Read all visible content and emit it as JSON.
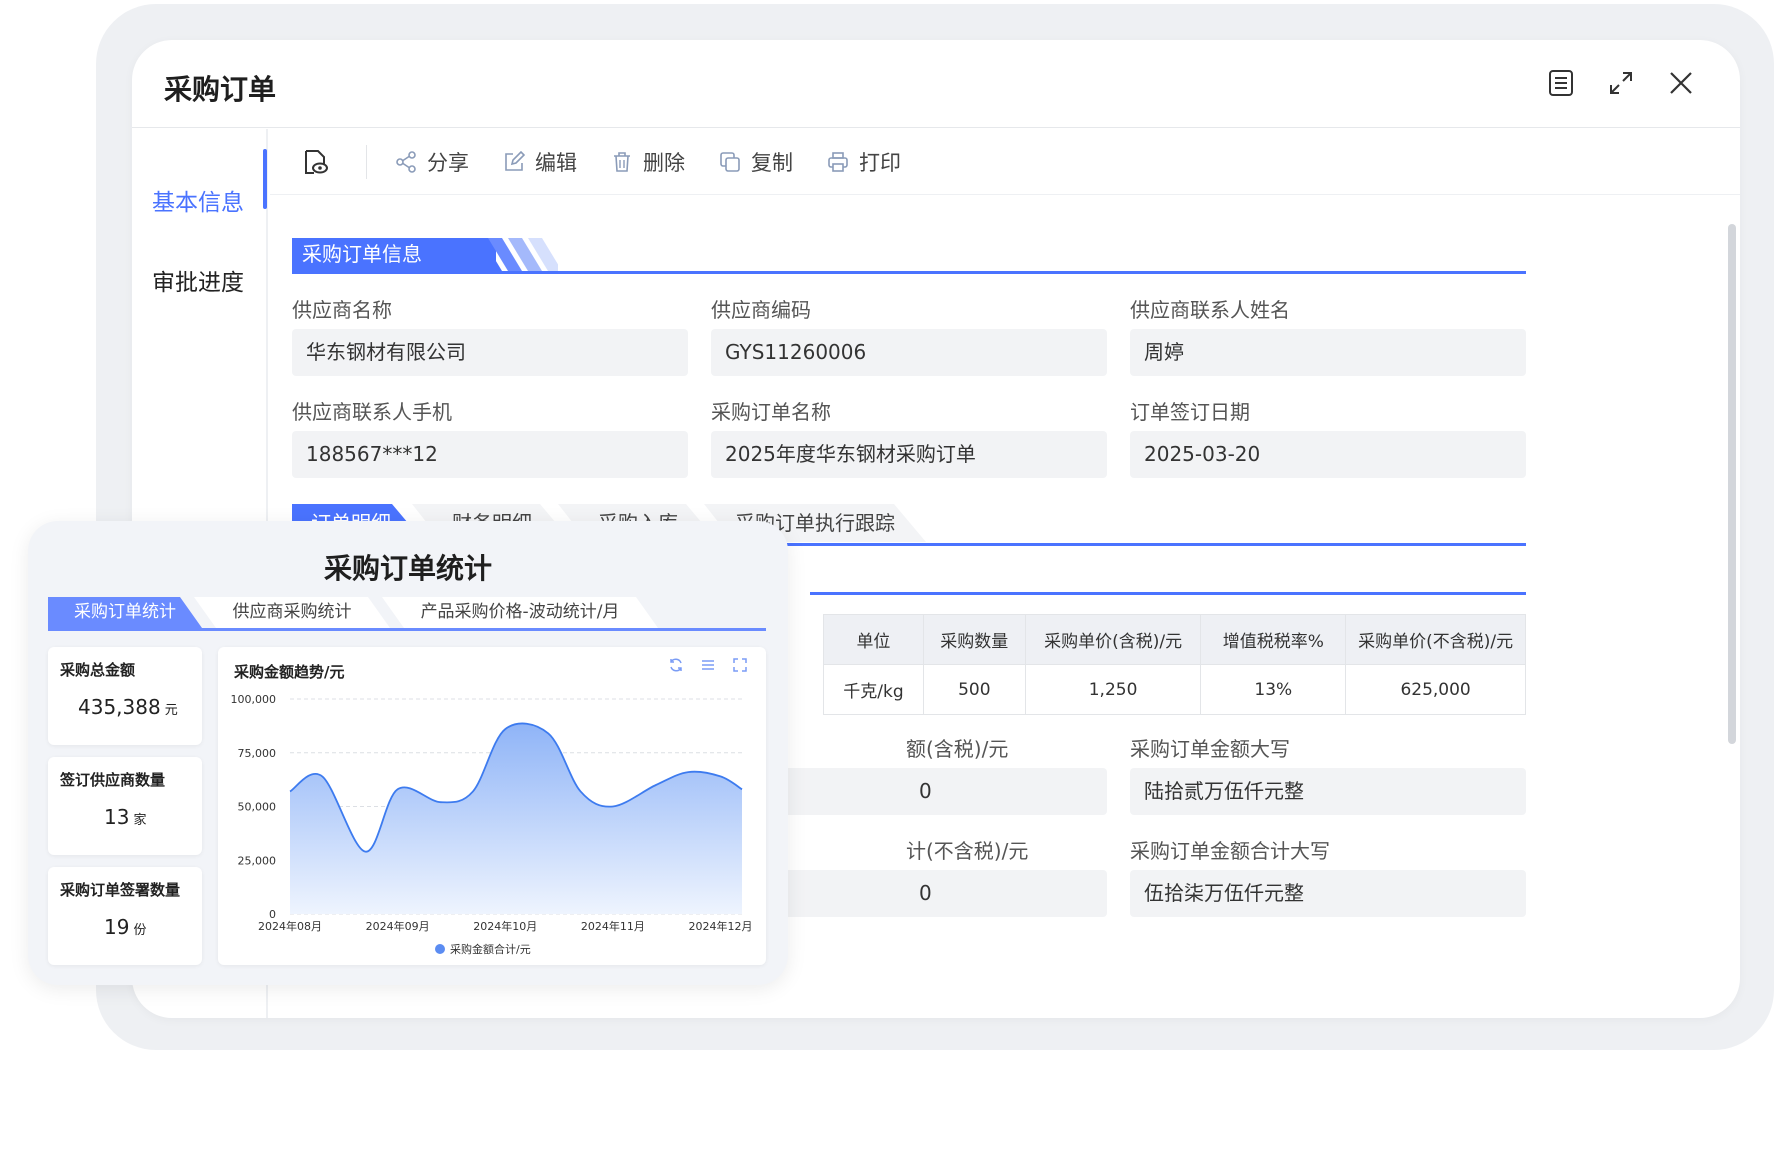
{
  "window": {
    "title": "采购订单",
    "icons": [
      "document-list-icon",
      "expand-icon",
      "close-icon"
    ]
  },
  "sidenav": {
    "items": [
      {
        "label": "基本信息",
        "active": true
      },
      {
        "label": "审批进度",
        "active": false
      }
    ]
  },
  "toolbar": {
    "preview_icon": "preview-eye-icon",
    "buttons": [
      {
        "label": "分享",
        "icon": "share-icon"
      },
      {
        "label": "编辑",
        "icon": "edit-icon"
      },
      {
        "label": "删除",
        "icon": "delete-icon"
      },
      {
        "label": "复制",
        "icon": "copy-icon"
      },
      {
        "label": "打印",
        "icon": "print-icon"
      }
    ]
  },
  "section": {
    "title": "采购订单信息"
  },
  "fields": [
    {
      "label": "供应商名称",
      "value": "华东钢材有限公司"
    },
    {
      "label": "供应商编码",
      "value": "GYS11260006"
    },
    {
      "label": "供应商联系人姓名",
      "value": "周婷"
    },
    {
      "label": "供应商联系人手机",
      "value": "188567***12"
    },
    {
      "label": "采购订单名称",
      "value": "2025年度华东钢材采购订单"
    },
    {
      "label": "订单签订日期",
      "value": "2025-03-20"
    }
  ],
  "tabs": [
    {
      "label": "订单明细",
      "active": true
    },
    {
      "label": "财务明细",
      "active": false
    },
    {
      "label": "采购入库",
      "active": false
    },
    {
      "label": "采购订单执行跟踪",
      "active": false
    }
  ],
  "table": {
    "headers": [
      "单位",
      "采购数量",
      "采购单价(含税)/元",
      "增值税税率%",
      "采购单价(不含税)/元"
    ],
    "rows": [
      [
        "千克/kg",
        "500",
        "1,250",
        "13%",
        "625,000"
      ]
    ]
  },
  "totals": {
    "tax_incl_label_partial": "额(含税)/元",
    "tax_incl_value_partial": "0",
    "tax_incl_upper_label": "采购订单金额大写",
    "tax_incl_upper_value": "陆拾贰万伍仟元整",
    "tax_excl_label_partial": "计(不含税)/元",
    "tax_excl_value_partial": "0",
    "tax_excl_upper_label": "采购订单金额合计大写",
    "tax_excl_upper_value": "伍拾柒万伍仟元整"
  },
  "stats": {
    "title": "采购订单统计",
    "tabs": [
      {
        "label": "采购订单统计",
        "active": true
      },
      {
        "label": "供应商采购统计",
        "active": false
      },
      {
        "label": "产品采购价格-波动统计/月",
        "active": false
      }
    ],
    "kpis": [
      {
        "label": "采购总金额",
        "value": "435,388",
        "unit": "元"
      },
      {
        "label": "签订供应商数量",
        "value": "13",
        "unit": "家"
      },
      {
        "label": "采购订单签署数量",
        "value": "19",
        "unit": "份"
      }
    ],
    "chart_tools": [
      "refresh-icon",
      "menu-icon",
      "fullscreen-icon"
    ]
  },
  "colors": {
    "accent": "#4a73ff",
    "chart_line": "#3d7bef",
    "chart_fill_top": "#8fb4f7",
    "chart_fill_bottom": "#eef4fe"
  },
  "chart_data": {
    "type": "area",
    "title": "采购金额趋势/元",
    "xlabel": "",
    "ylabel": "",
    "x": [
      "2024年08月",
      "2024年09月",
      "2024年10月",
      "2024年11月",
      "2024年12月"
    ],
    "series": [
      {
        "name": "采购金额合计/元",
        "x": [
          0,
          0.3,
          0.7,
          1.0,
          1.4,
          1.7,
          2.0,
          2.4,
          2.7,
          3.0,
          3.4,
          3.7,
          4.0,
          4.2
        ],
        "values": [
          57000,
          64000,
          29000,
          58000,
          52000,
          57000,
          86000,
          84000,
          57000,
          50000,
          60000,
          66000,
          64000,
          58000
        ]
      }
    ],
    "xlim": [
      0,
      4.2
    ],
    "ylim": [
      0,
      100000
    ],
    "yticks": [
      0,
      25000,
      50000,
      75000,
      100000
    ],
    "ytick_labels": [
      "0",
      "25,000",
      "50,000",
      "75,000",
      "100,000"
    ],
    "grid": true,
    "legend": "bottom"
  }
}
